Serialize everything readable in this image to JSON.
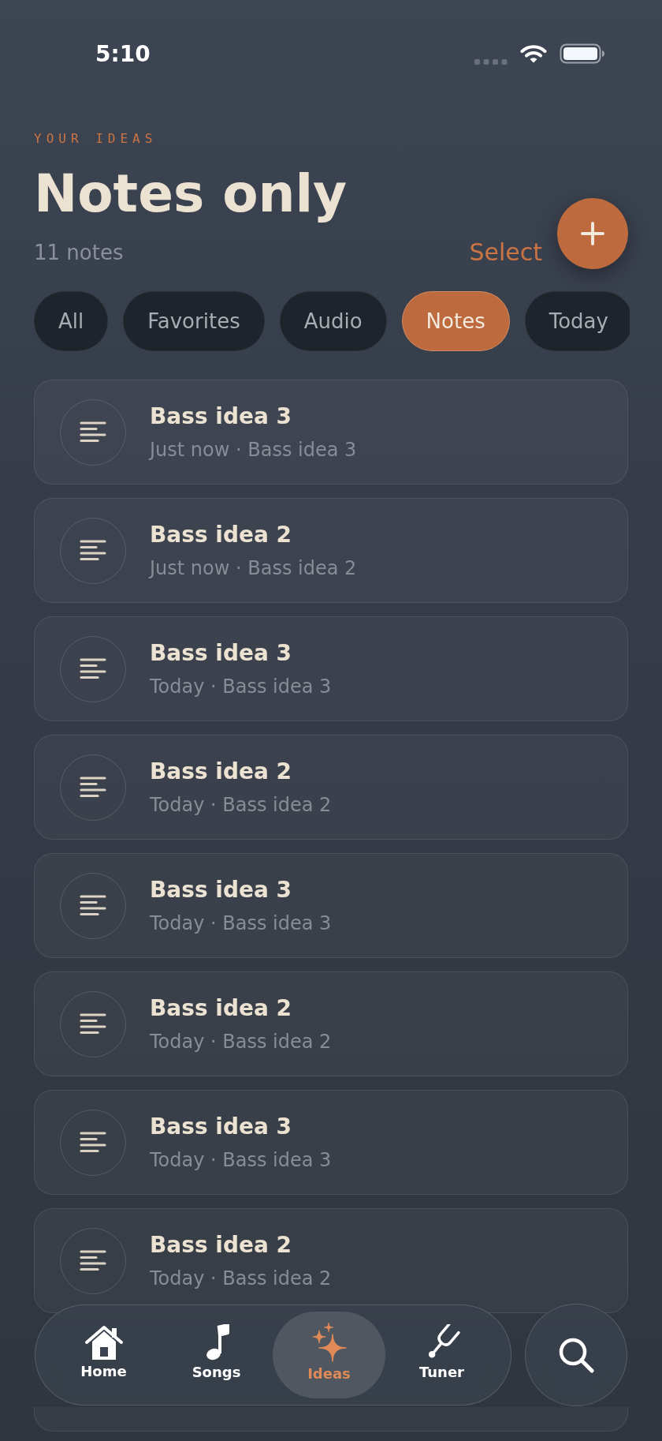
{
  "status_bar": {
    "time": "5:10"
  },
  "header": {
    "eyebrow": "YOUR IDEAS",
    "title": "Notes only",
    "count": "11 notes",
    "select": "Select"
  },
  "filters": [
    {
      "label": "All",
      "selected": false
    },
    {
      "label": "Favorites",
      "selected": false
    },
    {
      "label": "Audio",
      "selected": false
    },
    {
      "label": "Notes",
      "selected": true
    },
    {
      "label": "Today",
      "selected": false
    }
  ],
  "notes": [
    {
      "title": "Bass idea 3",
      "subtitle": "Just now · Bass idea 3"
    },
    {
      "title": "Bass idea 2",
      "subtitle": "Just now · Bass idea 2"
    },
    {
      "title": "Bass idea 3",
      "subtitle": "Today · Bass idea 3"
    },
    {
      "title": "Bass idea 2",
      "subtitle": "Today · Bass idea 2"
    },
    {
      "title": "Bass idea 3",
      "subtitle": "Today · Bass idea 3"
    },
    {
      "title": "Bass idea 2",
      "subtitle": "Today · Bass idea 2"
    },
    {
      "title": "Bass idea 3",
      "subtitle": "Today · Bass idea 3"
    },
    {
      "title": "Bass idea 2",
      "subtitle": "Today · Bass idea 2"
    }
  ],
  "tab_bar": {
    "tabs": [
      {
        "label": "Home",
        "selected": false
      },
      {
        "label": "Songs",
        "selected": false
      },
      {
        "label": "Ideas",
        "selected": true
      },
      {
        "label": "Tuner",
        "selected": false
      }
    ]
  }
}
